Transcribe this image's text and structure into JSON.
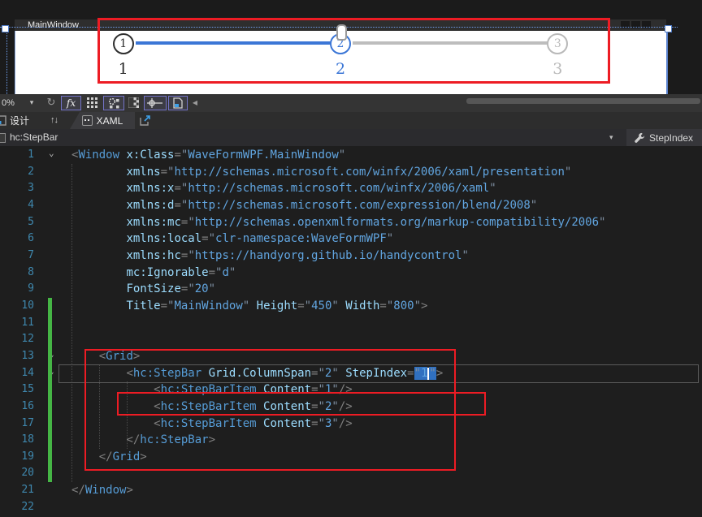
{
  "design": {
    "window_title": "MainWindow",
    "steps": [
      {
        "num": "1",
        "label": "1",
        "state": "done"
      },
      {
        "num": "2",
        "label": "2",
        "state": "current"
      },
      {
        "num": "3",
        "label": "3",
        "state": "waiting"
      }
    ],
    "colors": {
      "step_done": "#2f2f2f",
      "step_current": "#3b76d6",
      "step_waiting": "#b9b9b9",
      "annotation_red": "#ed1c24",
      "change_bar_green": "#45b545"
    },
    "icons": [
      "minimize-icon",
      "maximize-icon",
      "close-icon",
      "thumb-pin-icon"
    ]
  },
  "toolbar": {
    "zoom_value": "0%",
    "dropdown_glyph": "▾",
    "icons": [
      "refresh-icon",
      "effects-toggle-icon",
      "snap-grid-icon",
      "grid-options-toggle-icon",
      "transparency-icon",
      "snapping-toggle-icon",
      "document-outline-toggle-icon",
      "collapse-left-icon"
    ],
    "refresh_glyph": "↻",
    "fx_label": "fx",
    "collapse_glyph": "◀"
  },
  "tabs": {
    "design_label": "设计",
    "swap_glyph": "↑↓",
    "xaml_label": "XAML",
    "icons": [
      "design-view-icon",
      "swap-panes-icon",
      "xaml-view-icon",
      "popout-window-icon"
    ]
  },
  "breadcrumb": {
    "path": "hc:StepBar",
    "dropdown_glyph": "▾",
    "property": "StepIndex",
    "icons": [
      "element-icon",
      "wrench-icon"
    ]
  },
  "editor": {
    "lines": [
      {
        "n": 1,
        "fold": true,
        "segs": [
          [
            "d",
            "<"
          ],
          [
            "e",
            "Window"
          ],
          [
            "t",
            " "
          ],
          [
            "a",
            "x:Class"
          ],
          [
            "d",
            "="
          ],
          [
            "q",
            "\""
          ],
          [
            "v",
            "WaveFormWPF.MainWindow"
          ],
          [
            "q",
            "\""
          ]
        ]
      },
      {
        "n": 2,
        "segs": [
          [
            "t",
            "        "
          ],
          [
            "a",
            "xmlns"
          ],
          [
            "d",
            "="
          ],
          [
            "q",
            "\""
          ],
          [
            "v",
            "http://schemas.microsoft.com/winfx/2006/xaml/presentation"
          ],
          [
            "q",
            "\""
          ]
        ]
      },
      {
        "n": 3,
        "segs": [
          [
            "t",
            "        "
          ],
          [
            "a",
            "xmlns:x"
          ],
          [
            "d",
            "="
          ],
          [
            "q",
            "\""
          ],
          [
            "v",
            "http://schemas.microsoft.com/winfx/2006/xaml"
          ],
          [
            "q",
            "\""
          ]
        ]
      },
      {
        "n": 4,
        "segs": [
          [
            "t",
            "        "
          ],
          [
            "a",
            "xmlns:d"
          ],
          [
            "d",
            "="
          ],
          [
            "q",
            "\""
          ],
          [
            "v",
            "http://schemas.microsoft.com/expression/blend/2008"
          ],
          [
            "q",
            "\""
          ]
        ]
      },
      {
        "n": 5,
        "segs": [
          [
            "t",
            "        "
          ],
          [
            "a",
            "xmlns:mc"
          ],
          [
            "d",
            "="
          ],
          [
            "q",
            "\""
          ],
          [
            "v",
            "http://schemas.openxmlformats.org/markup-compatibility/2006"
          ],
          [
            "q",
            "\""
          ]
        ]
      },
      {
        "n": 6,
        "segs": [
          [
            "t",
            "        "
          ],
          [
            "a",
            "xmlns:local"
          ],
          [
            "d",
            "="
          ],
          [
            "q",
            "\""
          ],
          [
            "v",
            "clr-namespace:WaveFormWPF"
          ],
          [
            "q",
            "\""
          ]
        ]
      },
      {
        "n": 7,
        "segs": [
          [
            "t",
            "        "
          ],
          [
            "a",
            "xmlns:hc"
          ],
          [
            "d",
            "="
          ],
          [
            "q",
            "\""
          ],
          [
            "v",
            "https://handyorg.github.io/handycontrol"
          ],
          [
            "q",
            "\""
          ]
        ]
      },
      {
        "n": 8,
        "segs": [
          [
            "t",
            "        "
          ],
          [
            "a",
            "mc:Ignorable"
          ],
          [
            "d",
            "="
          ],
          [
            "q",
            "\""
          ],
          [
            "v",
            "d"
          ],
          [
            "q",
            "\""
          ]
        ]
      },
      {
        "n": 9,
        "segs": [
          [
            "t",
            "        "
          ],
          [
            "a",
            "FontSize"
          ],
          [
            "d",
            "="
          ],
          [
            "q",
            "\""
          ],
          [
            "v",
            "20"
          ],
          [
            "q",
            "\""
          ]
        ]
      },
      {
        "n": 10,
        "segs": [
          [
            "t",
            "        "
          ],
          [
            "a",
            "Title"
          ],
          [
            "d",
            "="
          ],
          [
            "q",
            "\""
          ],
          [
            "v",
            "MainWindow"
          ],
          [
            "q",
            "\""
          ],
          [
            "t",
            " "
          ],
          [
            "a",
            "Height"
          ],
          [
            "d",
            "="
          ],
          [
            "q",
            "\""
          ],
          [
            "v",
            "450"
          ],
          [
            "q",
            "\""
          ],
          [
            "t",
            " "
          ],
          [
            "a",
            "Width"
          ],
          [
            "d",
            "="
          ],
          [
            "q",
            "\""
          ],
          [
            "v",
            "800"
          ],
          [
            "q",
            "\""
          ],
          [
            "d",
            ">"
          ]
        ]
      },
      {
        "n": 11,
        "segs": []
      },
      {
        "n": 12,
        "segs": []
      },
      {
        "n": 13,
        "fold": true,
        "segs": [
          [
            "t",
            "    "
          ],
          [
            "d",
            "<"
          ],
          [
            "e",
            "Grid"
          ],
          [
            "d",
            ">"
          ]
        ]
      },
      {
        "n": 14,
        "fold": true,
        "segs": [
          [
            "t",
            "        "
          ],
          [
            "d",
            "<"
          ],
          [
            "e",
            "hc:StepBar"
          ],
          [
            "t",
            " "
          ],
          [
            "a",
            "Grid.ColumnSpan"
          ],
          [
            "d",
            "="
          ],
          [
            "q",
            "\""
          ],
          [
            "v",
            "2"
          ],
          [
            "q",
            "\""
          ],
          [
            "t",
            " "
          ],
          [
            "a",
            "StepIndex"
          ],
          [
            "d",
            "="
          ],
          [
            "sq",
            "\""
          ],
          [
            "sv",
            "1"
          ],
          [
            "cr",
            ""
          ],
          [
            "sq",
            "\""
          ],
          [
            "d",
            ">"
          ]
        ]
      },
      {
        "n": 15,
        "segs": [
          [
            "t",
            "            "
          ],
          [
            "d",
            "<"
          ],
          [
            "e",
            "hc:StepBarItem"
          ],
          [
            "t",
            " "
          ],
          [
            "a",
            "Content"
          ],
          [
            "d",
            "="
          ],
          [
            "q",
            "\""
          ],
          [
            "v",
            "1"
          ],
          [
            "q",
            "\""
          ],
          [
            "d",
            "/>"
          ]
        ]
      },
      {
        "n": 16,
        "segs": [
          [
            "t",
            "            "
          ],
          [
            "d",
            "<"
          ],
          [
            "e",
            "hc:StepBarItem"
          ],
          [
            "t",
            " "
          ],
          [
            "a",
            "Content"
          ],
          [
            "d",
            "="
          ],
          [
            "q",
            "\""
          ],
          [
            "v",
            "2"
          ],
          [
            "q",
            "\""
          ],
          [
            "d",
            "/>"
          ]
        ]
      },
      {
        "n": 17,
        "segs": [
          [
            "t",
            "            "
          ],
          [
            "d",
            "<"
          ],
          [
            "e",
            "hc:StepBarItem"
          ],
          [
            "t",
            " "
          ],
          [
            "a",
            "Content"
          ],
          [
            "d",
            "="
          ],
          [
            "q",
            "\""
          ],
          [
            "v",
            "3"
          ],
          [
            "q",
            "\""
          ],
          [
            "d",
            "/>"
          ]
        ]
      },
      {
        "n": 18,
        "segs": [
          [
            "t",
            "        "
          ],
          [
            "d",
            "</"
          ],
          [
            "e",
            "hc:StepBar"
          ],
          [
            "d",
            ">"
          ]
        ]
      },
      {
        "n": 19,
        "segs": [
          [
            "t",
            "    "
          ],
          [
            "d",
            "</"
          ],
          [
            "e",
            "Grid"
          ],
          [
            "d",
            ">"
          ]
        ]
      },
      {
        "n": 20,
        "segs": []
      },
      {
        "n": 21,
        "segs": [
          [
            "d",
            "</"
          ],
          [
            "e",
            "Window"
          ],
          [
            "d",
            ">"
          ]
        ]
      },
      {
        "n": 22,
        "segs": []
      }
    ]
  }
}
